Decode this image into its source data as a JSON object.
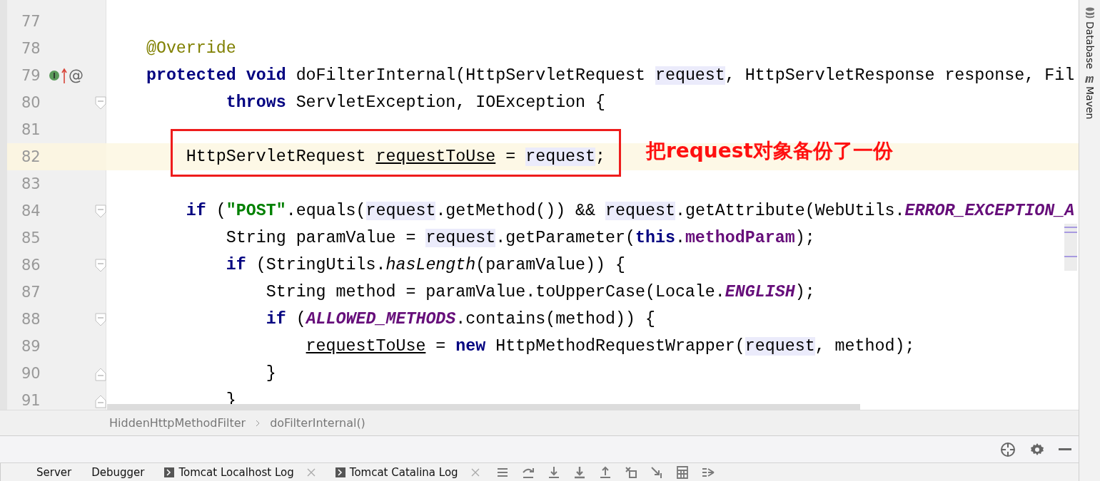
{
  "editor": {
    "lines": [
      {
        "number": "77"
      },
      {
        "number": "78",
        "tokens": [
          {
            "kind": "ann",
            "t": "    @Override"
          }
        ]
      },
      {
        "number": "79",
        "marks": [
          {
            "kind": "interface-badge"
          },
          {
            "kind": "arrow-up"
          },
          {
            "kind": "text",
            "text": "@"
          }
        ],
        "tokens": [
          {
            "kind": "kw",
            "t": "    protected"
          },
          {
            "kind": "kw",
            "t": " void"
          },
          {
            "kind": "plain",
            "t": " doFilterInternal(HttpServletRequest "
          },
          {
            "kind": "ref",
            "t": "request"
          },
          {
            "kind": "plain",
            "t": ", HttpServletResponse response, Fil"
          }
        ]
      },
      {
        "number": "80",
        "fold": {
          "kind": "open"
        },
        "tokens": [
          {
            "kind": "kw",
            "t": "            throws"
          },
          {
            "kind": "plain",
            "t": " ServletException, IOException {"
          }
        ]
      },
      {
        "number": "81"
      },
      {
        "number": "82",
        "current": true,
        "boxed": true,
        "note": "把request对象备份了一份",
        "tokens": [
          {
            "kind": "plain",
            "t": "        HttpServletRequest "
          },
          {
            "kind": "var",
            "t": "requestToUse"
          },
          {
            "kind": "plain",
            "t": " = "
          },
          {
            "kind": "ref",
            "t": "request"
          },
          {
            "kind": "plain",
            "t": ";"
          }
        ]
      },
      {
        "number": "83"
      },
      {
        "number": "84",
        "fold": {
          "kind": "open"
        },
        "tokens": [
          {
            "kind": "kw",
            "t": "        if"
          },
          {
            "kind": "plain",
            "t": " ("
          },
          {
            "kind": "str",
            "t": "\"POST\""
          },
          {
            "kind": "plain",
            "t": ".equals("
          },
          {
            "kind": "ref",
            "t": "request"
          },
          {
            "kind": "plain",
            "t": ".getMethod()) && "
          },
          {
            "kind": "ref",
            "t": "request"
          },
          {
            "kind": "plain",
            "t": ".getAttribute(WebUtils."
          },
          {
            "kind": "const",
            "t": "ERROR_EXCEPTION_A"
          }
        ]
      },
      {
        "number": "85",
        "tokens": [
          {
            "kind": "plain",
            "t": "            String paramValue = "
          },
          {
            "kind": "ref",
            "t": "request"
          },
          {
            "kind": "plain",
            "t": ".getParameter("
          },
          {
            "kind": "kw",
            "t": "this"
          },
          {
            "kind": "plain",
            "t": "."
          },
          {
            "kind": "field",
            "t": "methodParam"
          },
          {
            "kind": "plain",
            "t": ");"
          }
        ]
      },
      {
        "number": "86",
        "fold": {
          "kind": "open"
        },
        "tokens": [
          {
            "kind": "kw",
            "t": "            if"
          },
          {
            "kind": "plain",
            "t": " (StringUtils."
          },
          {
            "kind": "italic",
            "t": "hasLength"
          },
          {
            "kind": "plain",
            "t": "(paramValue)) {"
          }
        ]
      },
      {
        "number": "87",
        "tokens": [
          {
            "kind": "plain",
            "t": "                String method = paramValue.toUpperCase(Locale."
          },
          {
            "kind": "const",
            "t": "ENGLISH"
          },
          {
            "kind": "plain",
            "t": ");"
          }
        ]
      },
      {
        "number": "88",
        "fold": {
          "kind": "open"
        },
        "tokens": [
          {
            "kind": "kw",
            "t": "                if"
          },
          {
            "kind": "plain",
            "t": " ("
          },
          {
            "kind": "const",
            "t": "ALLOWED_METHODS"
          },
          {
            "kind": "plain",
            "t": ".contains(method)) {"
          }
        ]
      },
      {
        "number": "89",
        "tokens": [
          {
            "kind": "var",
            "t": "                    requestToUse"
          },
          {
            "kind": "plain",
            "t": " = "
          },
          {
            "kind": "kw",
            "t": "new"
          },
          {
            "kind": "plain",
            "t": " HttpMethodRequestWrapper("
          },
          {
            "kind": "ref",
            "t": "request"
          },
          {
            "kind": "plain",
            "t": ", method);"
          }
        ]
      },
      {
        "number": "90",
        "fold": {
          "kind": "close"
        },
        "tokens": [
          {
            "kind": "plain",
            "t": "                }"
          }
        ]
      },
      {
        "number": "91",
        "fold": {
          "kind": "close"
        },
        "tokens": [
          {
            "kind": "plain",
            "t": "            }"
          }
        ]
      }
    ]
  },
  "breadcrumbs": [
    "HiddenHttpMethodFilter",
    "doFilterInternal()"
  ],
  "right_toolbar": [
    {
      "label": "Database",
      "kind": "database"
    },
    {
      "label": "Maven",
      "kind": "maven"
    }
  ],
  "tool_window": {
    "actions": [
      {
        "kind": "target"
      },
      {
        "kind": "gear"
      },
      {
        "kind": "minimize"
      }
    ]
  },
  "tabs": [
    {
      "label": "Server",
      "kind": "plain",
      "closable": false
    },
    {
      "label": "Debugger",
      "kind": "plain",
      "closable": false
    },
    {
      "label": "Tomcat Localhost Log",
      "kind": "log",
      "closable": true
    },
    {
      "label": "Tomcat Catalina Log",
      "kind": "log",
      "closable": true
    }
  ],
  "toolbar": [
    {
      "kind": "lines"
    },
    {
      "kind": "step-over"
    },
    {
      "kind": "step-into"
    },
    {
      "kind": "force-step-into"
    },
    {
      "kind": "step-out"
    },
    {
      "kind": "drop-frame"
    },
    {
      "kind": "run-to-cursor"
    },
    {
      "kind": "calculator"
    },
    {
      "kind": "trace"
    }
  ]
}
